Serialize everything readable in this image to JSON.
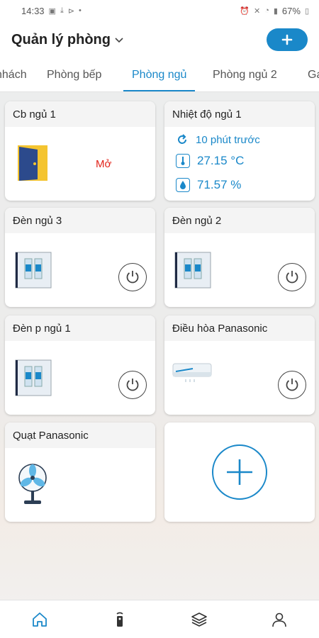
{
  "status_bar": {
    "time": "14:33",
    "battery": "67%"
  },
  "header": {
    "title": "Quản lý phòng",
    "add_label": "+"
  },
  "tabs": [
    {
      "label": "nhách",
      "active": false
    },
    {
      "label": "Phòng bếp",
      "active": false
    },
    {
      "label": "Phòng ngủ",
      "active": true
    },
    {
      "label": "Phòng ngủ 2",
      "active": false
    },
    {
      "label": "Ga",
      "active": false
    }
  ],
  "devices": [
    {
      "name": "Cb ngủ 1",
      "type": "door-sensor",
      "status": "Mở"
    },
    {
      "name": "Nhiệt độ ngủ 1",
      "type": "temp-sensor",
      "updated": "10 phút trước",
      "temperature": "27.15 °C",
      "humidity": "71.57 %"
    },
    {
      "name": "Đèn ngủ 3",
      "type": "light-switch"
    },
    {
      "name": "Đèn ngủ 2",
      "type": "light-switch"
    },
    {
      "name": "Đèn p ngủ 1",
      "type": "light-switch"
    },
    {
      "name": "Điều hòa Panasonic",
      "type": "air-conditioner"
    },
    {
      "name": "Quạt Panasonic",
      "type": "fan"
    }
  ],
  "colors": {
    "accent": "#1a88c9",
    "status_open": "#e2231a"
  },
  "bottom_nav": [
    "home-icon",
    "remote-icon",
    "layers-icon",
    "user-icon"
  ]
}
